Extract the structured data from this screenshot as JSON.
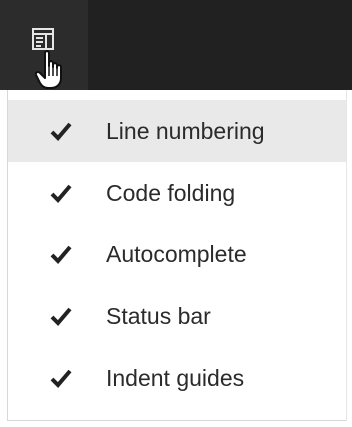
{
  "toolbar": {
    "view_icon": "panel-layout-icon",
    "cursor": "hand-pointer-icon"
  },
  "menu": {
    "items": [
      {
        "label": "Line numbering",
        "checked": true,
        "highlighted": true
      },
      {
        "label": "Code folding",
        "checked": true,
        "highlighted": false
      },
      {
        "label": "Autocomplete",
        "checked": true,
        "highlighted": false
      },
      {
        "label": "Status bar",
        "checked": true,
        "highlighted": false
      },
      {
        "label": "Indent guides",
        "checked": true,
        "highlighted": false
      }
    ]
  },
  "colors": {
    "toolbar_bg": "#212121",
    "button_bg": "#2c2c2c",
    "highlight_bg": "#e9e9e9",
    "text": "#2b2b2b",
    "check": "#222222"
  }
}
